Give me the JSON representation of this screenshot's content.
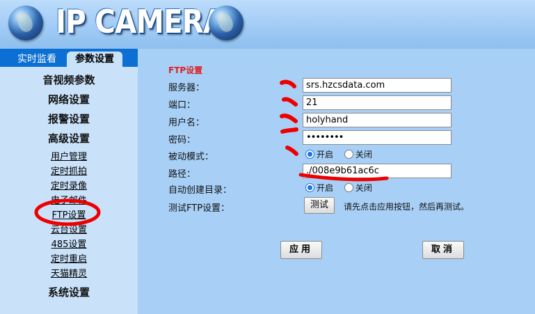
{
  "header": {
    "logo_text": "IP CAMERA",
    "left_icon": "globe-icon",
    "right_icon": "globe-icon"
  },
  "tabs": {
    "live": "实时监看",
    "settings": "参数设置",
    "active": "settings"
  },
  "sidebar": {
    "groups": [
      "音视频参数",
      "网络设置",
      "报警设置",
      "高级设置"
    ],
    "sub_items": [
      "用户管理",
      "定时抓拍",
      "定时录像",
      "电子邮件",
      "FTP设置",
      "云台设置",
      "485设置",
      "定时重启",
      "天猫精灵"
    ],
    "active_item": "FTP设置",
    "bottom_group": "系统设置"
  },
  "ftp": {
    "section_title": "FTP设置",
    "server_label": "服务器：",
    "server_value": "srs.hzcsdata.com",
    "port_label": "端口：",
    "port_value": "21",
    "username_label": "用户名：",
    "username_value": "holyhand",
    "password_label": "密码：",
    "password_value": "••••••••",
    "passive_label": "被动模式：",
    "passive_on": "开启",
    "passive_off": "关闭",
    "passive_selected": "开启",
    "path_label": "路径：",
    "path_value": "./008e9b61ac6c",
    "autocreate_label": "自动创建目录：",
    "autocreate_on": "开启",
    "autocreate_off": "关闭",
    "autocreate_selected": "开启",
    "test_label": "测试FTP设置：",
    "test_button": "测试",
    "test_hint": "请先点击应用按钮，然后再测试。"
  },
  "actions": {
    "apply": "应用",
    "cancel": "取消"
  },
  "colors": {
    "tab_bar": "#0b6fd4",
    "sidebar_bg": "#c9e2fa",
    "content_bg": "#a8d0f7",
    "section_title": "#dd2222",
    "annotation_marks": "#ee0000"
  }
}
